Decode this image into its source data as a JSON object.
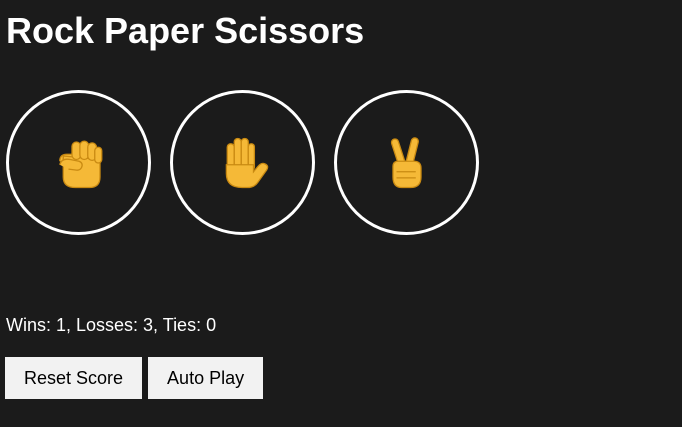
{
  "title": "Rock Paper Scissors",
  "moves": [
    {
      "id": "rock",
      "icon": "raised-fist-icon"
    },
    {
      "id": "paper",
      "icon": "raised-hand-icon"
    },
    {
      "id": "scissors",
      "icon": "victory-hand-icon"
    }
  ],
  "score_text": "Wins: 1, Losses: 3, Ties: 0",
  "controls": {
    "reset_label": "Reset Score",
    "autoplay_label": "Auto Play"
  },
  "colors": {
    "background": "#1b1b1b",
    "text": "#ffffff",
    "icon": "#f5b937",
    "button_bg": "#f2f2f2"
  }
}
